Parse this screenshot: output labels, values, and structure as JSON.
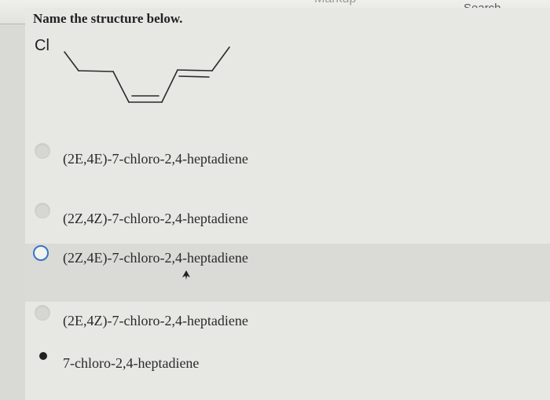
{
  "header": {
    "tab_label": "Markup",
    "search_label": "Search"
  },
  "question": {
    "title": "Name the structure below.",
    "atom_label": "Cl"
  },
  "options": [
    {
      "label": "(2E,4E)-7-chloro-2,4-heptadiene",
      "state": "unselected"
    },
    {
      "label": "(2Z,4Z)-7-chloro-2,4-heptadiene",
      "state": "unselected"
    },
    {
      "label": "(2Z,4E)-7-chloro-2,4-heptadiene",
      "state": "hovered"
    },
    {
      "label": "(2E,4Z)-7-chloro-2,4-heptadiene",
      "state": "unselected"
    },
    {
      "label": "7-chloro-2,4-heptadiene",
      "state": "selected"
    }
  ],
  "colors": {
    "radio_hover_border": "#3a74c4",
    "selected_dot": "#222222"
  }
}
